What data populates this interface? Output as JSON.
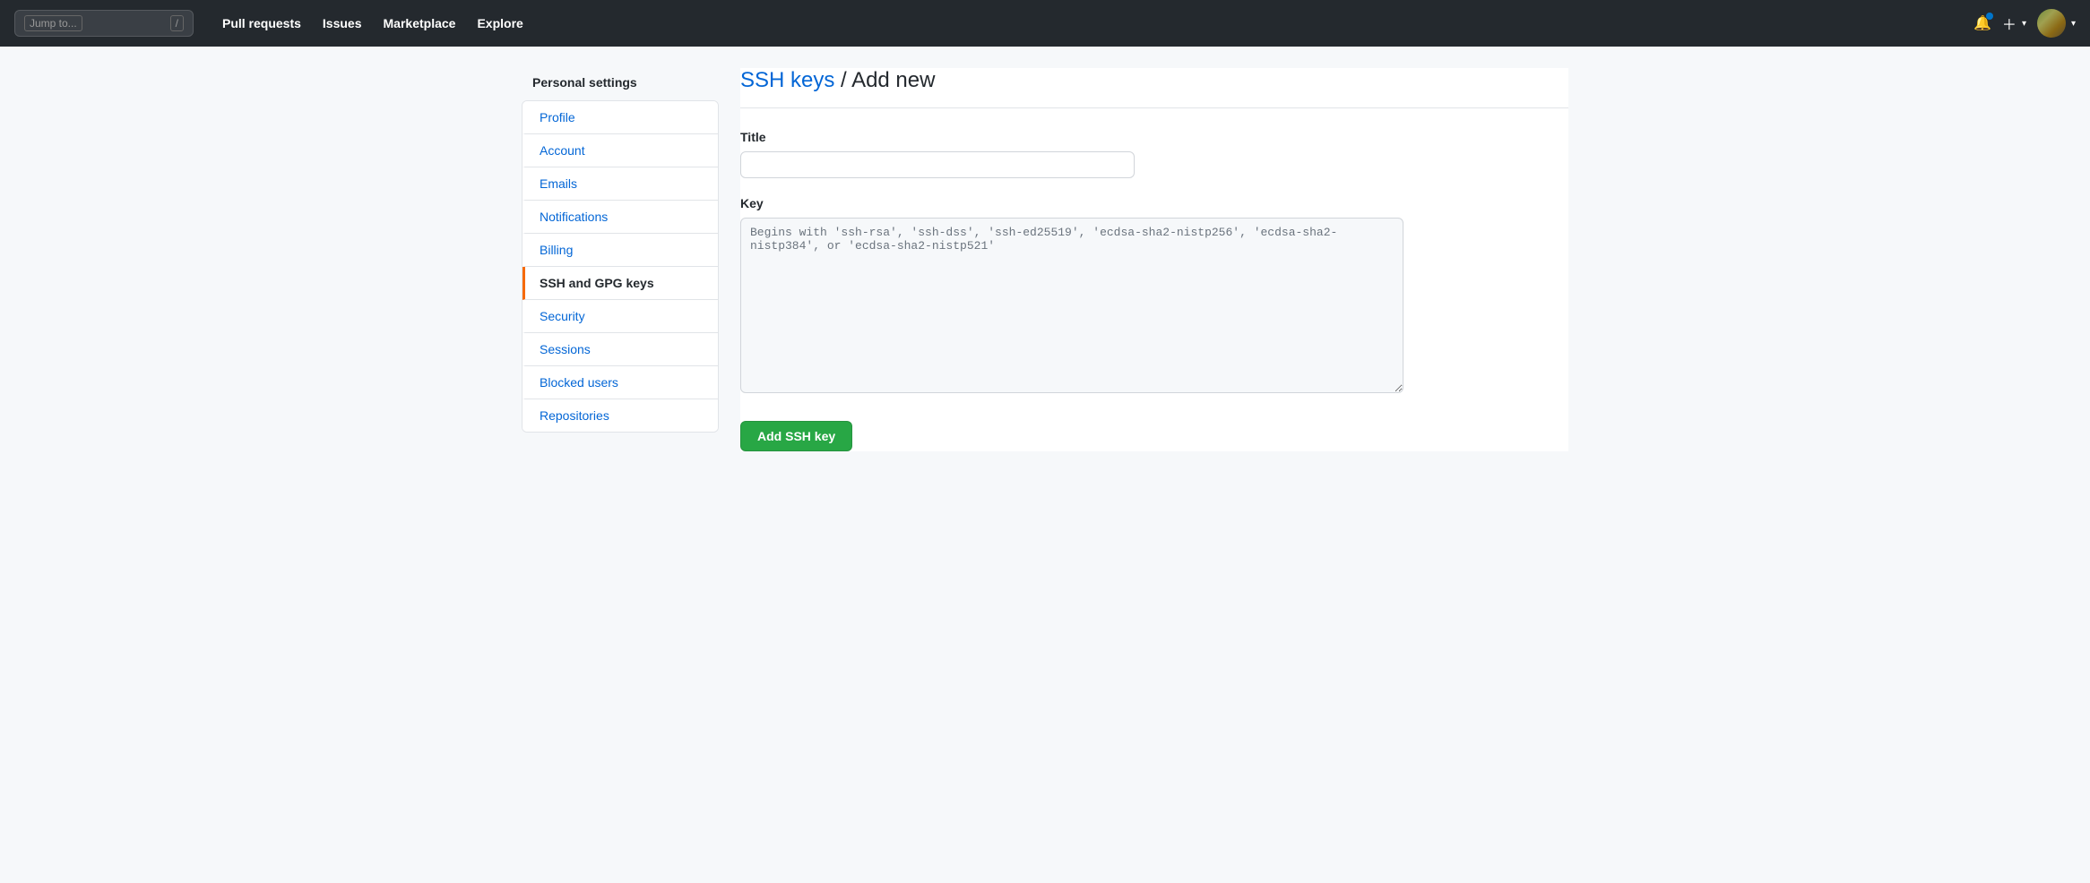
{
  "navbar": {
    "search_placeholder": "Jump to...",
    "search_shortcut": "/",
    "links": [
      {
        "label": "Pull requests",
        "name": "pull-requests-link"
      },
      {
        "label": "Issues",
        "name": "issues-link"
      },
      {
        "label": "Marketplace",
        "name": "marketplace-link"
      },
      {
        "label": "Explore",
        "name": "explore-link"
      }
    ]
  },
  "sidebar": {
    "title": "Personal settings",
    "items": [
      {
        "label": "Profile",
        "name": "sidebar-item-profile",
        "active": false
      },
      {
        "label": "Account",
        "name": "sidebar-item-account",
        "active": false
      },
      {
        "label": "Emails",
        "name": "sidebar-item-emails",
        "active": false
      },
      {
        "label": "Notifications",
        "name": "sidebar-item-notifications",
        "active": false
      },
      {
        "label": "Billing",
        "name": "sidebar-item-billing",
        "active": false
      },
      {
        "label": "SSH and GPG keys",
        "name": "sidebar-item-ssh",
        "active": true
      },
      {
        "label": "Security",
        "name": "sidebar-item-security",
        "active": false
      },
      {
        "label": "Sessions",
        "name": "sidebar-item-sessions",
        "active": false
      },
      {
        "label": "Blocked users",
        "name": "sidebar-item-blocked",
        "active": false
      },
      {
        "label": "Repositories",
        "name": "sidebar-item-repositories",
        "active": false
      }
    ]
  },
  "main": {
    "breadcrumb_link": "SSH keys",
    "breadcrumb_separator": " / ",
    "breadcrumb_current": "Add new",
    "title_label": "Title",
    "title_placeholder": "",
    "key_label": "Key",
    "key_placeholder": "Begins with 'ssh-rsa', 'ssh-dss', 'ssh-ed25519', 'ecdsa-sha2-nistp256', 'ecdsa-sha2-nistp384', or 'ecdsa-sha2-nistp521'",
    "submit_button": "Add SSH key"
  }
}
